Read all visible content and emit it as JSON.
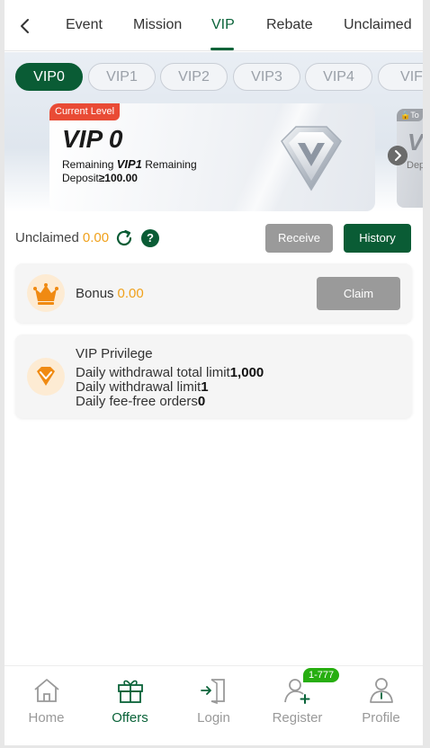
{
  "topnav": {
    "tabs": [
      {
        "label": "Event"
      },
      {
        "label": "Mission"
      },
      {
        "label": "VIP"
      },
      {
        "label": "Rebate"
      },
      {
        "label": "Unclaimed"
      }
    ],
    "active_tab": "VIP"
  },
  "vip_levels": [
    "VIP0",
    "VIP1",
    "VIP2",
    "VIP3",
    "VIP4",
    "VIF"
  ],
  "current_card": {
    "tag": "Current Level",
    "title": "VIP 0",
    "remaining_prefix": "Remaining",
    "next_level": "VIP1",
    "remaining_suffix": "Remaining",
    "deposit_label": "Deposit",
    "deposit_amount": "≥100.00"
  },
  "next_card": {
    "tag": "To",
    "title": "V",
    "sub": "Dep"
  },
  "unclaimed": {
    "label": "Unclaimed",
    "value": "0.00",
    "receive_label": "Receive",
    "history_label": "History"
  },
  "bonus": {
    "label": "Bonus",
    "value": "0.00",
    "claim_label": "Claim"
  },
  "privilege": {
    "title": "VIP Privilege",
    "lines": [
      {
        "label": "Daily withdrawal total limit",
        "value": "1,000"
      },
      {
        "label": "Daily withdrawal limit",
        "value": "1"
      },
      {
        "label": "Daily fee-free orders",
        "value": "0"
      }
    ]
  },
  "bottomnav": {
    "items": [
      {
        "label": "Home",
        "icon": "home-icon"
      },
      {
        "label": "Offers",
        "icon": "gift-icon"
      },
      {
        "label": "Login",
        "icon": "login-icon"
      },
      {
        "label": "Register",
        "icon": "add-user-icon"
      },
      {
        "label": "Profile",
        "icon": "profile-icon"
      }
    ],
    "active": "Offers",
    "register_badge": "1-777"
  },
  "colors": {
    "brand_green": "#0a5c35",
    "accent_orange": "#f0a11b",
    "level_tag_red": "#e94b35",
    "disabled_gray": "#9a9a9a"
  }
}
